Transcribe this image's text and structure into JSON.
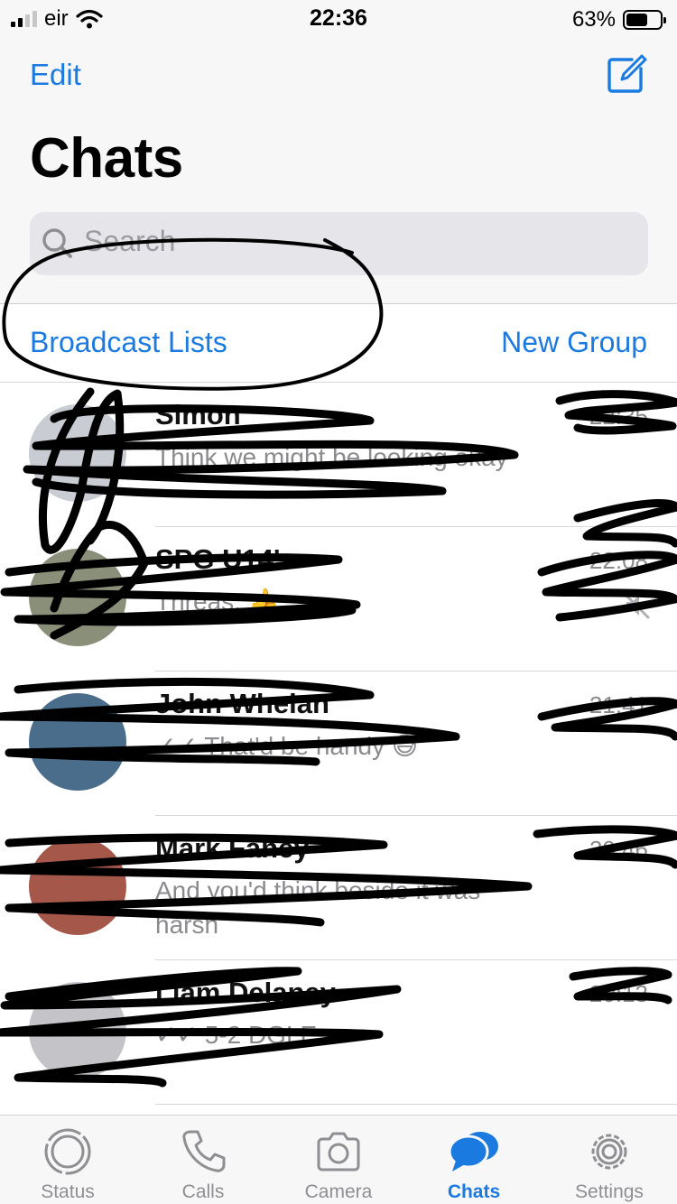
{
  "status_bar": {
    "carrier": "eir",
    "time": "22:36",
    "battery_percent_text": "63%",
    "battery_level": 0.63
  },
  "header": {
    "edit_label": "Edit",
    "compose_icon": "compose-icon",
    "title": "Chats"
  },
  "search": {
    "placeholder": "Search"
  },
  "actions": {
    "broadcast_label": "Broadcast Lists",
    "new_group_label": "New Group"
  },
  "chats": [
    {
      "name": "Simon",
      "preview": "Think we might be looking okay",
      "time": "22:35",
      "avatar_color": "#c9ccd2",
      "muted": false
    },
    {
      "name": "SPG U14's",
      "preview": "Threas: 👍",
      "time": "22:08",
      "avatar_color": "#8a8f7a",
      "muted": true
    },
    {
      "name": "John Whelan",
      "preview": "✓✓ That'd be handy 😅",
      "time": "21:41",
      "avatar_color": "#4a6d8c",
      "muted": false
    },
    {
      "name": "Mark Fahey",
      "preview": "And you'd think beside it was harsh",
      "time": "20:46",
      "avatar_color": "#a5584a",
      "muted": false
    },
    {
      "name": "Liam Delaney",
      "preview": "✓✓ 5-2 DGLE",
      "time": "20:13",
      "avatar_color": "#c4c4c8",
      "muted": false
    }
  ],
  "tabs": [
    {
      "label": "Status",
      "icon": "status-icon",
      "active": false
    },
    {
      "label": "Calls",
      "icon": "phone-icon",
      "active": false
    },
    {
      "label": "Camera",
      "icon": "camera-icon",
      "active": false
    },
    {
      "label": "Chats",
      "icon": "chats-icon",
      "active": true
    },
    {
      "label": "Settings",
      "icon": "gear-icon",
      "active": false
    }
  ],
  "colors": {
    "accent": "#1a7ae0",
    "secondary_text": "#8a8a8f",
    "scribble": "#000000"
  }
}
